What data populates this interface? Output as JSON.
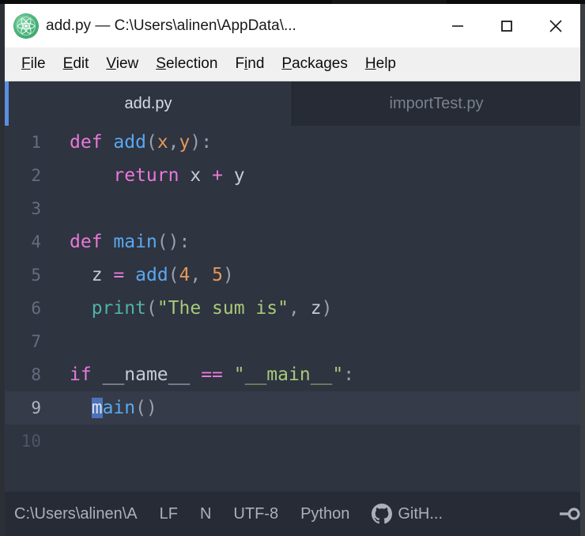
{
  "window": {
    "title": "add.py — C:\\Users\\alinen\\AppData\\...",
    "app_icon": "atom-logo-icon",
    "controls": {
      "minimize": "minimize-icon",
      "maximize": "maximize-icon",
      "close": "close-icon"
    }
  },
  "menubar": {
    "items": [
      {
        "label": "File",
        "accel_index": 0
      },
      {
        "label": "Edit",
        "accel_index": 0
      },
      {
        "label": "View",
        "accel_index": 0
      },
      {
        "label": "Selection",
        "accel_index": 0
      },
      {
        "label": "Find",
        "accel_index": 1
      },
      {
        "label": "Packages",
        "accel_index": 0
      },
      {
        "label": "Help",
        "accel_index": 0
      }
    ]
  },
  "tabs": [
    {
      "label": "add.py",
      "active": true
    },
    {
      "label": "importTest.py",
      "active": false
    }
  ],
  "editor": {
    "active_line": 9,
    "lines": [
      {
        "n": "1",
        "text": "def add(x,y):"
      },
      {
        "n": "2",
        "text": "    return x + y"
      },
      {
        "n": "3",
        "text": ""
      },
      {
        "n": "4",
        "text": "def main():"
      },
      {
        "n": "5",
        "text": "  z = add(4, 5)"
      },
      {
        "n": "6",
        "text": "  print(\"The sum is\", z)"
      },
      {
        "n": "7",
        "text": ""
      },
      {
        "n": "8",
        "text": "if __name__ == \"__main__\":"
      },
      {
        "n": "9",
        "text": "  main()"
      },
      {
        "n": "10",
        "text": ""
      }
    ],
    "cursor_char": "m"
  },
  "statusbar": {
    "path": "C:\\Users\\alinen\\A",
    "line_ending": "LF",
    "indicator": "N",
    "encoding": "UTF-8",
    "grammar": "Python",
    "github_label": "GitH...",
    "github_icon": "github-icon",
    "branch_icon": "git-branch-icon"
  },
  "colors": {
    "editor_bg": "#2e3440",
    "tabbar_bg": "#262b35",
    "active_tab_bg": "#2e3440",
    "accent_blue": "#5a8fe0",
    "keyword": "#e879d8",
    "function": "#5aa8f2",
    "string": "#a8c97a",
    "number": "#e39857",
    "builtin": "#4fb3a5",
    "cursor_selection": "#4a72b8"
  }
}
